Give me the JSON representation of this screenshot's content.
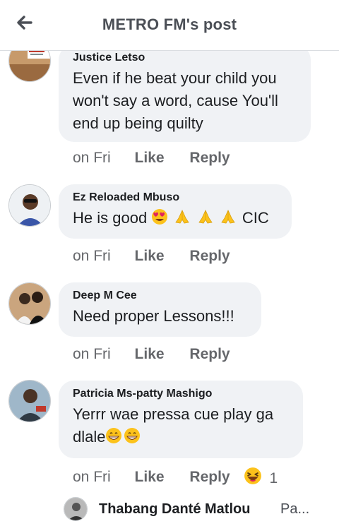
{
  "header": {
    "title": "METRO FM's post",
    "back_icon": "arrow-left-icon"
  },
  "comments": [
    {
      "author": "Justice Letso",
      "text": "Even if he beat your child you won't say a word, cause You'll end up being quilty",
      "time": "on Fri",
      "like": "Like",
      "reply": "Reply"
    },
    {
      "author": "Ez Reloaded Mbuso",
      "text_start": "He is good",
      "emojis": [
        "heart-eyes-emoji",
        "folded-hands-emoji",
        "folded-hands-emoji",
        "folded-hands-emoji"
      ],
      "text_end": "CIC",
      "time": "on Fri",
      "like": "Like",
      "reply": "Reply"
    },
    {
      "author": "Deep M Cee",
      "text": "Need proper Lessons!!!",
      "time": "on Fri",
      "like": "Like",
      "reply": "Reply"
    },
    {
      "author": "Patricia Ms-patty Mashigo",
      "text_line1": "Yerrr wae pressa cue play ga",
      "text_line2": "dlale",
      "emojis": [
        "grinning-emoji",
        "grinning-emoji"
      ],
      "time": "on Fri",
      "like": "Like",
      "reply": "Reply",
      "reaction_icon": "laughing-emoji",
      "reaction_count": "1"
    }
  ],
  "reply_preview": {
    "name": "Thabang Danté Matlou",
    "snippet": "Pa..."
  },
  "colors": {
    "bubble": "#f0f2f5",
    "meta_text": "#65676b",
    "header_text": "#4b4f56"
  }
}
